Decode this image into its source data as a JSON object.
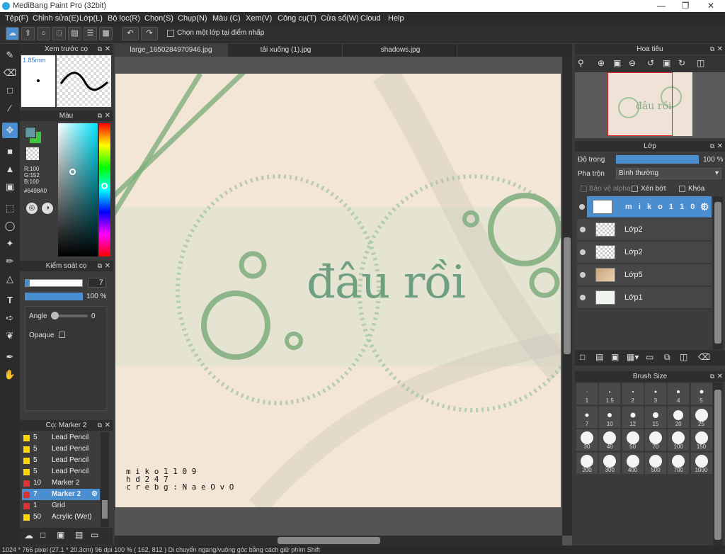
{
  "window": {
    "title": "MediBang Paint Pro (32bit)"
  },
  "menu": [
    "Tệp(F)",
    "Chỉnh sửa(E)",
    "Lớp(L)",
    "Bộ lọc(R)",
    "Chọn(S)",
    "Chụp(N)",
    "Màu (C)",
    "Xem(V)",
    "Công cụ(T)",
    "Cửa sổ(W)",
    "Cloud",
    "Help"
  ],
  "toolbar": {
    "select_layer_label": "Chọn một lớp tại điểm nhấp"
  },
  "tabs": [
    "large_1650284970946.jpg",
    "tải xuống (1).jpg",
    "shadows.jpg"
  ],
  "preview": {
    "title": "Xem trước cọ",
    "size": "1.85mm"
  },
  "color": {
    "title": "Màu",
    "r": "R:100",
    "g": "G:152",
    "b": "B:160",
    "hex": "#6498A0",
    "fg": "#6498a0"
  },
  "brushctrl": {
    "title": "Kiểm soát cọ",
    "size_val": "7",
    "opacity": "100 %",
    "angle_label": "Angle",
    "angle_val": "0",
    "opaque_label": "Opaque"
  },
  "brushlist": {
    "title": "Cọ: Marker 2",
    "items": [
      {
        "n": "5",
        "l": "Lead Pencil (B)",
        "c": "#ffd400"
      },
      {
        "n": "5",
        "l": "Lead Pencil (B)",
        "c": "#ffd400"
      },
      {
        "n": "5",
        "l": "Lead Pencil (B)",
        "c": "#ffd400"
      },
      {
        "n": "5",
        "l": "Lead Pencil (B)",
        "c": "#ffd400"
      },
      {
        "n": "10",
        "l": "Marker 2",
        "c": "#e03030"
      },
      {
        "n": "7",
        "l": "Marker 2",
        "c": "#e03030",
        "sel": true
      },
      {
        "n": "1",
        "l": "Grid",
        "c": "#e03030"
      },
      {
        "n": "50",
        "l": "Acrylic (Wet)",
        "c": "#ffd400"
      }
    ]
  },
  "canvas_text": {
    "main": "đâu rồi",
    "credit1": "m i k o 1 1 0 9",
    "credit2": "h d 2 4 7",
    "credit3": "c r e b g : N a e O v O"
  },
  "navigator": {
    "title": "Hoa tiêu"
  },
  "layers": {
    "title": "Lớp",
    "opacity_label": "Độ trong",
    "opacity_val": "100 %",
    "blend_label": "Pha trộn",
    "blend_val": "Bình thường",
    "protect_alpha": "Bảo vệ alpha",
    "clip": "Xén bớt",
    "lock": "Khóa",
    "items": [
      "m i k o 1 1 0 9",
      "Lớp2",
      "Lớp2",
      "Lớp5",
      "Lớp1"
    ]
  },
  "brushsize": {
    "title": "Brush Size",
    "sizes": [
      "1",
      "1.5",
      "2",
      "3",
      "4",
      "5",
      "7",
      "10",
      "12",
      "15",
      "20",
      "25",
      "30",
      "40",
      "50",
      "70",
      "100",
      "150",
      "200",
      "300",
      "400",
      "500",
      "700",
      "1000"
    ]
  },
  "status": {
    "text": "1024 * 766 pixel  (27.1 * 20.3cm)  96 dpi  100 %  ( 162, 812 )  Di chuyển ngang/vuông góc bằng cách giữ phím Shift"
  }
}
